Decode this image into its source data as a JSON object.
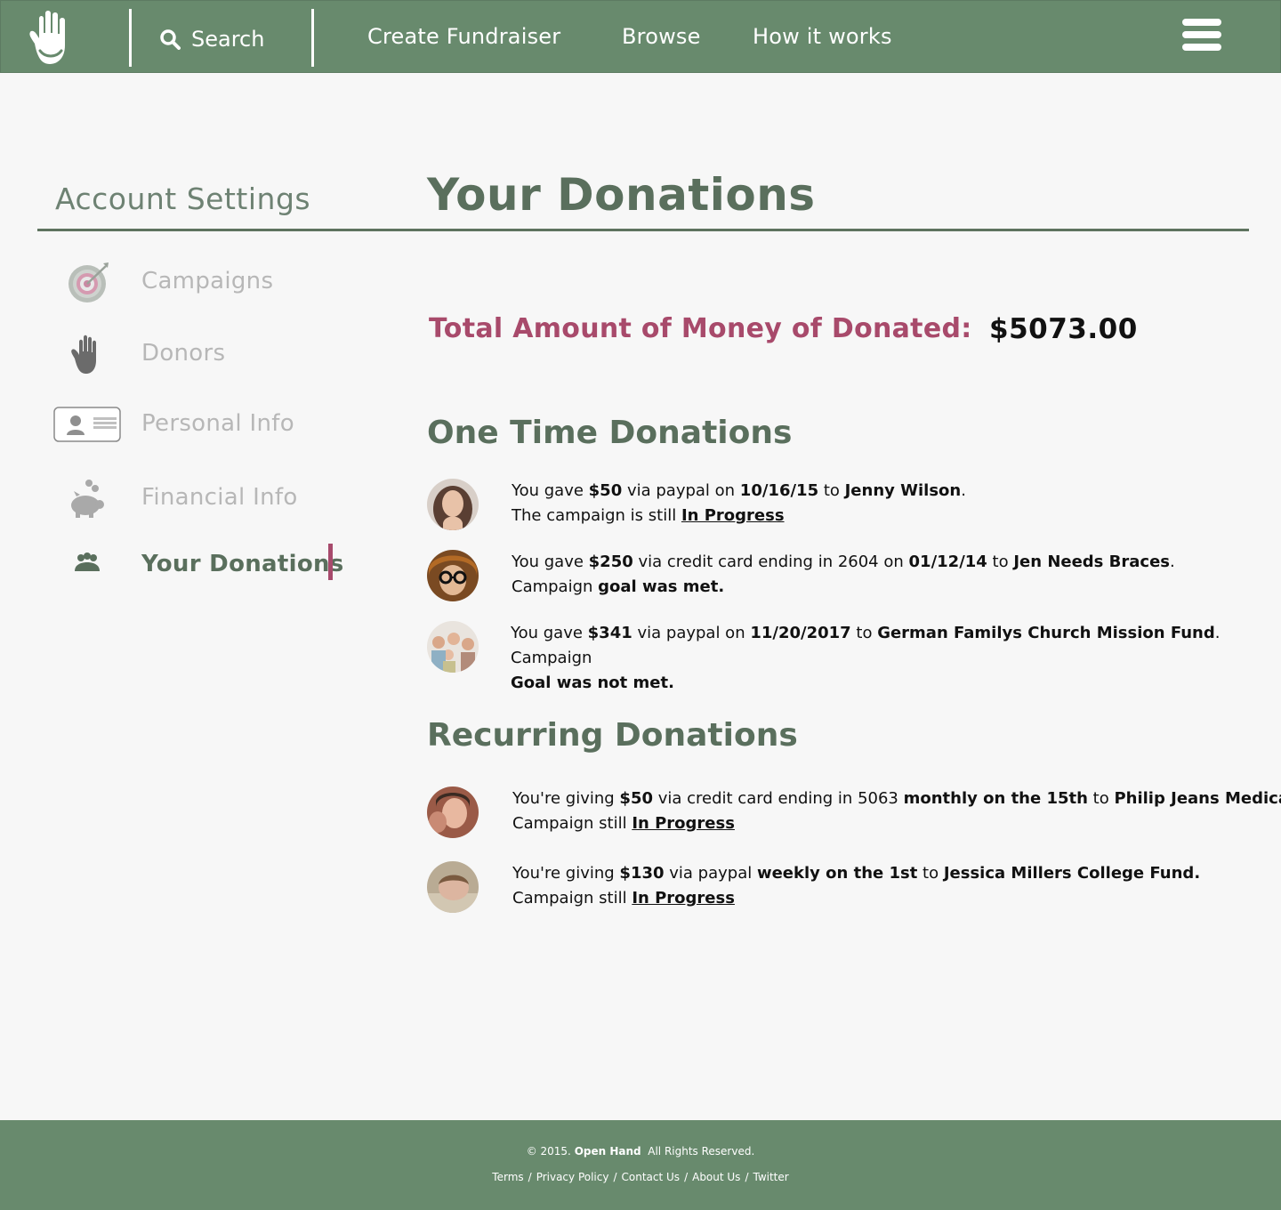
{
  "header": {
    "search_label": "Search",
    "nav": [
      "Create Fundraiser",
      "Browse",
      "How it works"
    ]
  },
  "sidebar": {
    "title": "Account Settings",
    "items": [
      {
        "label": "Campaigns",
        "icon": "target-icon"
      },
      {
        "label": "Donors",
        "icon": "hand-icon"
      },
      {
        "label": "Personal Info",
        "icon": "id-card-icon"
      },
      {
        "label": "Financial Info",
        "icon": "piggy-bank-icon"
      },
      {
        "label": "Your Donations",
        "icon": "people-icon",
        "active": true
      }
    ]
  },
  "main": {
    "title": "Your Donations",
    "total_label": "Total Amount of Money of Donated:",
    "total_value": "$5073.00",
    "one_time": {
      "title": "One Time Donations",
      "items": [
        {
          "prefix": "You gave ",
          "amount": "$50",
          "method": " via paypal on ",
          "date": "10/16/15",
          "to": " to ",
          "recipient": "Jenny Wilson",
          "end": ".",
          "line2_prefix": "The campaign is still ",
          "status": "In Progress",
          "line2_bold": ""
        },
        {
          "prefix": "You gave ",
          "amount": "$250",
          "method": " via credit card ending in 2604 on ",
          "date": "01/12/14",
          "to": " to ",
          "recipient": "Jen Needs Braces",
          "end": ".",
          "line2_prefix": "Campaign ",
          "status": "",
          "line2_bold": "goal was met."
        },
        {
          "prefix": "You gave ",
          "amount": "$341",
          "method": " via paypal on ",
          "date": "11/20/2017",
          "to": " to ",
          "recipient": "German Familys Church Mission Fund",
          "end": ". Campaign",
          "line2_prefix": "",
          "status": "",
          "line2_bold": "Goal was not met."
        }
      ]
    },
    "recurring": {
      "title": "Recurring Donations",
      "items": [
        {
          "prefix": "You're giving ",
          "amount": "$50",
          "method": " via credit card ending in 5063 ",
          "schedule": "monthly on the 15th",
          "to": " to ",
          "recipient": "Philip Jeans Medical Bills.",
          "line2_prefix": "Campaign still ",
          "status": "In Progress"
        },
        {
          "prefix": "You're giving ",
          "amount": "$130",
          "method": " via paypal ",
          "schedule": "weekly on the 1st",
          "to": " to ",
          "recipient": "Jessica Millers College Fund.",
          "line2_prefix": "Campaign still ",
          "status": "In Progress"
        }
      ]
    }
  },
  "footer": {
    "copyright_prefix": "© 2015. ",
    "brand": "Open Hand",
    "copyright_suffix": "  All Rights Reserved.",
    "links": [
      "Terms",
      "Privacy Policy",
      "Contact Us",
      "About Us",
      "Twitter"
    ]
  },
  "colors": {
    "brand_green": "#688a6d",
    "heading_green": "#5a6f5d",
    "accent_rose": "#a84a6b",
    "muted_gray": "#b7b7b7"
  }
}
